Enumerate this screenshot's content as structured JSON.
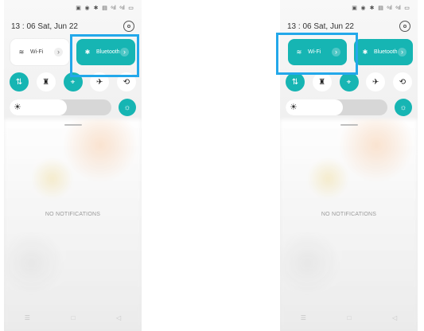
{
  "colors": {
    "accent": "#16b5b3",
    "highlight": "#23a8ea"
  },
  "left_phone": {
    "status_icons": [
      "photo-icon",
      "app-icon",
      "bluetooth-icon",
      "mail-icon",
      "signal-icon",
      "signal-icon",
      "battery-icon"
    ],
    "status_glyphs": [
      "▣",
      "◉",
      "✱",
      "▤",
      "⁶ıl",
      "⁶ıl",
      "▭"
    ],
    "time": "13 : 06",
    "date": "Sat, Jun 22",
    "wifi": {
      "label": "Wi-Fi",
      "state": "off",
      "icon": "wifi-icon"
    },
    "bluetooth": {
      "label": "Bluetooth",
      "state": "on",
      "icon": "bluetooth-icon"
    },
    "toggles": [
      {
        "name": "mobile-data",
        "glyph": "⇅",
        "state": "on",
        "icon": "mobile-data-icon"
      },
      {
        "name": "flashlight",
        "glyph": "♜",
        "state": "off",
        "icon": "flashlight-icon"
      },
      {
        "name": "location",
        "glyph": "⌖",
        "state": "on",
        "icon": "location-icon"
      },
      {
        "name": "airplane-mode",
        "glyph": "✈",
        "state": "off",
        "icon": "airplane-icon"
      },
      {
        "name": "auto-rotate",
        "glyph": "⟲",
        "state": "off",
        "icon": "rotate-icon"
      }
    ],
    "brightness": {
      "level": 0.56,
      "icon": "sun-icon",
      "auto_icon": "auto-brightness-icon"
    },
    "no_notifications": "NO NOTIFICATIONS",
    "nav": {
      "menu": "☰",
      "home": "□",
      "back": "◁"
    }
  },
  "right_phone": {
    "status_icons": [
      "photo-icon",
      "app-icon",
      "bluetooth-icon",
      "mail-icon",
      "signal-icon",
      "signal-icon",
      "battery-icon"
    ],
    "status_glyphs": [
      "▣",
      "◉",
      "✱",
      "▤",
      "⁶ıl",
      "⁶ıl",
      "▭"
    ],
    "time": "13 : 06",
    "date": "Sat, Jun 22",
    "wifi": {
      "label": "Wi-Fi",
      "state": "on",
      "icon": "wifi-icon"
    },
    "bluetooth": {
      "label": "Bluetooth",
      "state": "on",
      "icon": "bluetooth-icon"
    },
    "toggles": [
      {
        "name": "mobile-data",
        "glyph": "⇅",
        "state": "on",
        "icon": "mobile-data-icon"
      },
      {
        "name": "flashlight",
        "glyph": "♜",
        "state": "off",
        "icon": "flashlight-icon"
      },
      {
        "name": "location",
        "glyph": "⌖",
        "state": "on",
        "icon": "location-icon"
      },
      {
        "name": "airplane-mode",
        "glyph": "✈",
        "state": "off",
        "icon": "airplane-icon"
      },
      {
        "name": "auto-rotate",
        "glyph": "⟲",
        "state": "off",
        "icon": "rotate-icon"
      }
    ],
    "brightness": {
      "level": 0.56,
      "icon": "sun-icon",
      "auto_icon": "auto-brightness-icon"
    },
    "no_notifications": "NO NOTIFICATIONS",
    "nav": {
      "menu": "☰",
      "home": "□",
      "back": "◁"
    }
  }
}
